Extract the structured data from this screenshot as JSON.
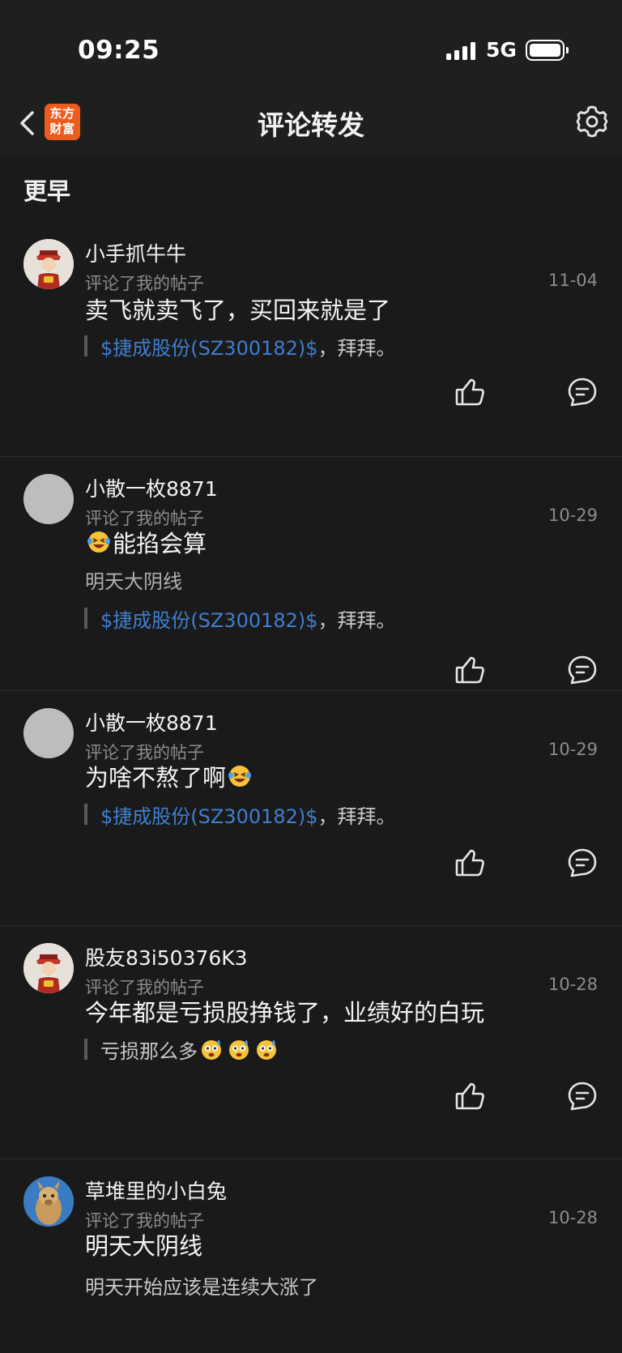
{
  "status_bar": {
    "time": "09:25",
    "network": "5G"
  },
  "nav": {
    "title": "评论转发",
    "logo_line1": "东方",
    "logo_line2": "财富"
  },
  "section": {
    "label": "更早"
  },
  "items": [
    {
      "username": "小手抓牛牛",
      "action": "评论了我的帖子",
      "date": "11-04",
      "content": "卖飞就卖飞了，买回来就是了",
      "quote_link": "$捷成股份(SZ300182)$",
      "quote_text": "，拜拜。",
      "avatar": "caishen-avatar"
    },
    {
      "username": "小散一枚8871",
      "action": "评论了我的帖子",
      "date": "10-29",
      "content": "能掐会算",
      "subtext": "明天大阴线",
      "quote_link": "$捷成股份(SZ300182)$",
      "quote_text": "，拜拜。",
      "avatar": "default-avatar"
    },
    {
      "username": "小散一枚8871",
      "action": "评论了我的帖子",
      "date": "10-29",
      "content": "为啥不熬了啊",
      "quote_link": "$捷成股份(SZ300182)$",
      "quote_text": "，拜拜。",
      "avatar": "default-avatar"
    },
    {
      "username": "股友83i50376K3",
      "action": "评论了我的帖子",
      "date": "10-28",
      "content": "今年都是亏损股挣钱了，业绩好的白玩",
      "quote_text": "亏损那么多",
      "avatar": "caishen-avatar"
    },
    {
      "username": "草堆里的小白兔",
      "action": "评论了我的帖子",
      "date": "10-28",
      "content": "明天大阴线",
      "subtext": "明天开始应该是连续大涨了",
      "avatar": "alpaca-avatar"
    }
  ]
}
